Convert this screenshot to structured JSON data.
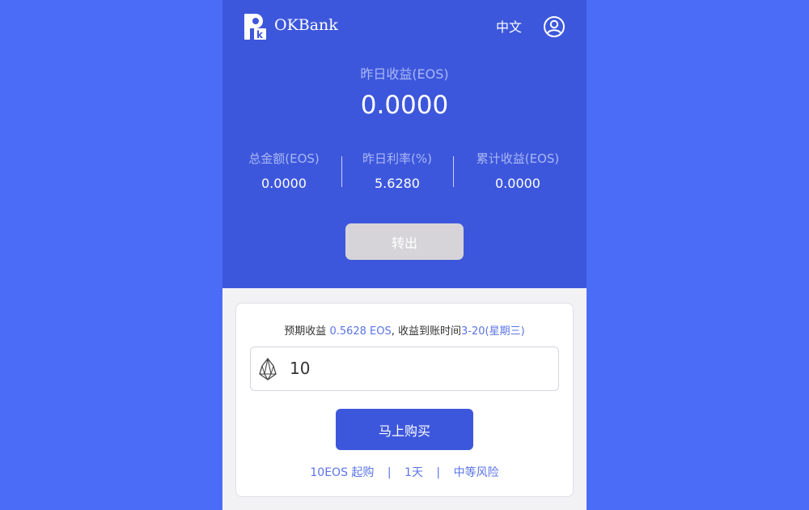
{
  "header": {
    "brand": "OKBank",
    "language": "中文",
    "logo_icon": "okbank-logo",
    "user_icon": "user-circle-icon"
  },
  "summary": {
    "yesterday_label": "昨日收益(EOS)",
    "yesterday_value": "0.0000",
    "stats": [
      {
        "label": "总金额(EOS)",
        "value": "0.0000"
      },
      {
        "label": "昨日利率(%)",
        "value": "5.6280"
      },
      {
        "label": "累计收益(EOS)",
        "value": "0.0000"
      }
    ],
    "transfer_button": "转出"
  },
  "purchase": {
    "expect_prefix": "预期收益 ",
    "expect_amount": "0.5628 EOS",
    "expect_middle": ", 收益到账时间",
    "expect_date": "3-20(星期三)",
    "amount_value": "10",
    "currency_icon": "eos-icon",
    "buy_button": "马上购买",
    "info": [
      "10EOS 起购",
      "1天",
      "中等风险"
    ],
    "separator": "|"
  },
  "colors": {
    "background": "#4b6cf7",
    "primary": "#3d57dc",
    "accent_text": "#5a74e6",
    "disabled_button": "#d6d4d8"
  }
}
